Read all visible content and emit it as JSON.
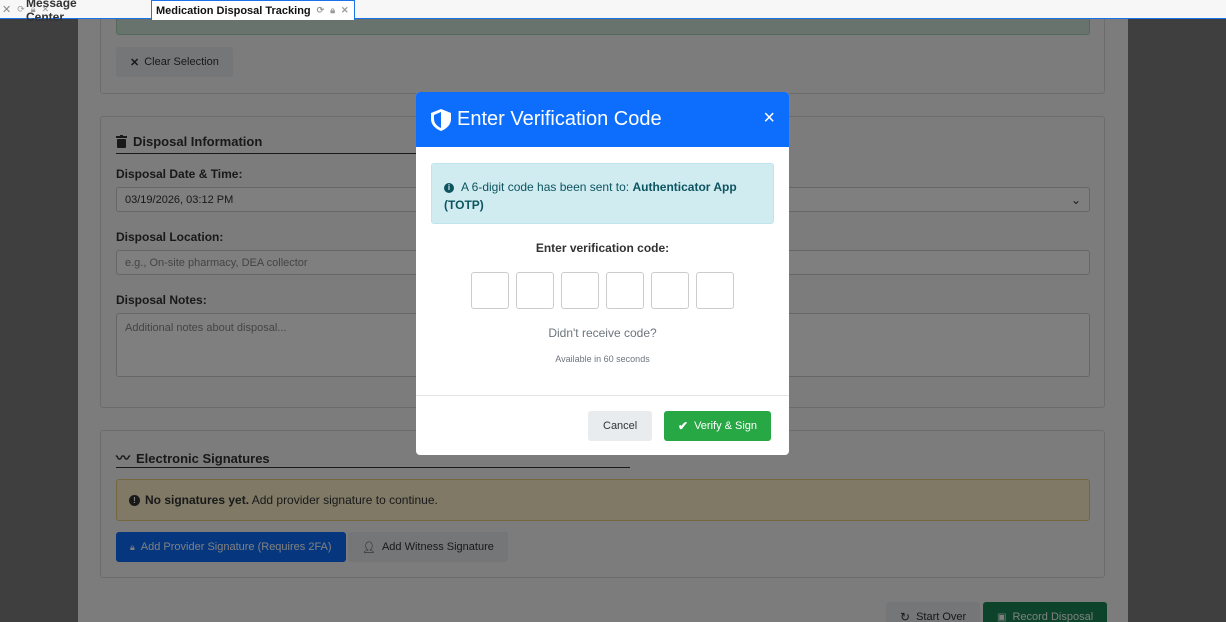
{
  "tabs": [
    {
      "label": "Message Center"
    },
    {
      "label": "Medication Disposal Tracking"
    }
  ],
  "page": {
    "clear_selection": "Clear Selection",
    "disposal_info_title": "Disposal Information",
    "disposal_datetime_label": "Disposal Date & Time:",
    "disposal_datetime_value": "03/19/2026, 03:12 PM",
    "disposal_location_label": "Disposal Location:",
    "disposal_location_placeholder": "e.g., On-site pharmacy, DEA collector",
    "disposal_notes_label": "Disposal Notes:",
    "disposal_notes_placeholder": "Additional notes about disposal...",
    "signatures_title": "Electronic Signatures",
    "no_sig_bold": "No signatures yet.",
    "no_sig_text": " Add provider signature to continue.",
    "add_provider_sig": "Add Provider Signature (Requires 2FA)",
    "add_witness_sig": "Add Witness Signature",
    "start_over": "Start Over",
    "record_disposal": "Record Disposal"
  },
  "modal": {
    "title": "Enter Verification Code",
    "close": "×",
    "info_prefix": "A 6-digit code has been sent to: ",
    "info_method": "Authenticator App (TOTP)",
    "enter_label": "Enter verification code:",
    "resend_text": "Didn't receive code?",
    "available_text": "Available in 60 seconds",
    "cancel": "Cancel",
    "verify": "Verify & Sign"
  },
  "colors": {
    "primary": "#0d6efd",
    "success": "#28a745",
    "info_bg": "#d1ecf1",
    "warning_bg": "#fff3cd"
  }
}
